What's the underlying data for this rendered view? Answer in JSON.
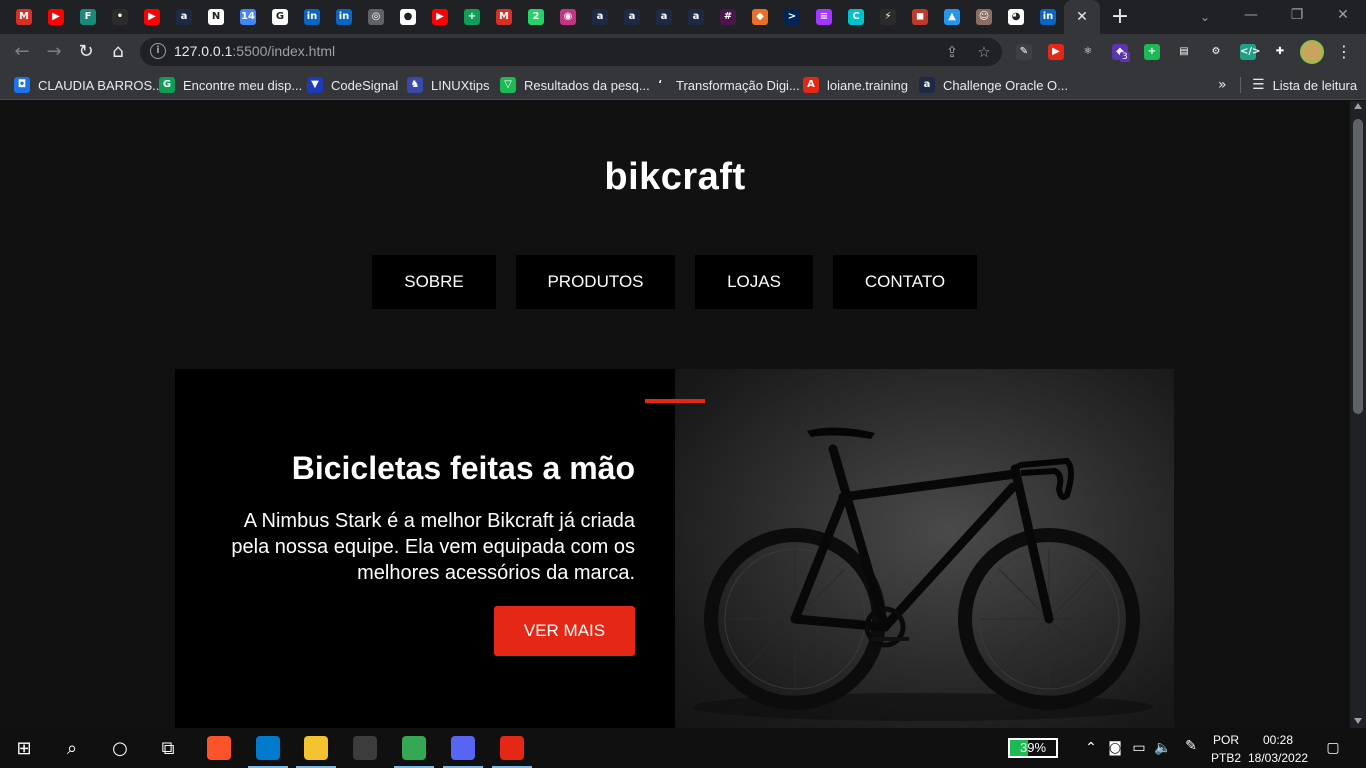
{
  "browser": {
    "url_host": "127.0.0.1",
    "url_rest": ":5500/index.html",
    "active_tab_close": "✕",
    "new_tab": "+"
  },
  "tab_icons": [
    {
      "name": "gmail-tab-icon",
      "color": "#d93025",
      "glyph": "M"
    },
    {
      "name": "youtube-tab-icon",
      "color": "#ff0000",
      "glyph": "▶"
    },
    {
      "name": "forms-tab-icon",
      "color": "#1a8a7a",
      "glyph": "F"
    },
    {
      "name": "dark-tab-icon",
      "color": "#2b2b2b",
      "glyph": "•"
    },
    {
      "name": "youtube-tab-icon",
      "color": "#ff0000",
      "glyph": "▶"
    },
    {
      "name": "alura-tab-icon",
      "color": "#1e2a44",
      "glyph": "a"
    },
    {
      "name": "notion-tab-icon",
      "color": "#ffffff",
      "glyph": "N"
    },
    {
      "name": "calendar-tab-icon",
      "color": "#4285f4",
      "glyph": "14"
    },
    {
      "name": "google-tab-icon",
      "color": "#ffffff",
      "glyph": "G"
    },
    {
      "name": "linkedin-tab-icon",
      "color": "#0a66c2",
      "glyph": "in"
    },
    {
      "name": "linkedin-tab-icon",
      "color": "#0a66c2",
      "glyph": "in"
    },
    {
      "name": "globe-tab-icon",
      "color": "#5f6368",
      "glyph": "◎"
    },
    {
      "name": "record-tab-icon",
      "color": "#ffffff",
      "glyph": "●"
    },
    {
      "name": "youtube-tab-icon",
      "color": "#ff0000",
      "glyph": "▶"
    },
    {
      "name": "sheets-tab-icon",
      "color": "#0f9d58",
      "glyph": "+"
    },
    {
      "name": "gmail-tab-icon",
      "color": "#d93025",
      "glyph": "M"
    },
    {
      "name": "whatsapp-tab-icon",
      "color": "#25d366",
      "glyph": "2"
    },
    {
      "name": "instagram-tab-icon",
      "color": "#c13584",
      "glyph": "◉"
    },
    {
      "name": "alura-tab-icon",
      "color": "#1e2a44",
      "glyph": "a"
    },
    {
      "name": "alura-tab-icon",
      "color": "#1e2a44",
      "glyph": "a"
    },
    {
      "name": "alura-tab-icon",
      "color": "#1e2a44",
      "glyph": "a"
    },
    {
      "name": "alura-tab-icon",
      "color": "#1e2a44",
      "glyph": "a"
    },
    {
      "name": "slack-tab-icon",
      "color": "#4a154b",
      "glyph": "#"
    },
    {
      "name": "app-tab-icon",
      "color": "#e8702a",
      "glyph": "◆"
    },
    {
      "name": "powershell-tab-icon",
      "color": "#012456",
      "glyph": ">"
    },
    {
      "name": "deezer-tab-icon",
      "color": "#a238ff",
      "glyph": "≡"
    },
    {
      "name": "canva-tab-icon",
      "color": "#00c4cc",
      "glyph": "C"
    },
    {
      "name": "bolt-tab-icon",
      "color": "#2b2b2b",
      "glyph": "⚡"
    },
    {
      "name": "app-tab-icon",
      "color": "#c0392b",
      "glyph": "◼"
    },
    {
      "name": "docker-tab-icon",
      "color": "#2496ed",
      "glyph": "▲"
    },
    {
      "name": "avatar-tab-icon",
      "color": "#8d6e63",
      "glyph": "☺"
    },
    {
      "name": "github-tab-icon",
      "color": "#ffffff",
      "glyph": "◕"
    },
    {
      "name": "linkedin-tab-icon",
      "color": "#0a66c2",
      "glyph": "in"
    }
  ],
  "extensions": [
    {
      "name": "pen-extension-icon",
      "color": "#3c4043",
      "glyph": "✎"
    },
    {
      "name": "youtube-extension-icon",
      "color": "#e52815",
      "glyph": "▶"
    },
    {
      "name": "react-devtools-extension-icon",
      "color": "#35363a",
      "glyph": "⚛"
    },
    {
      "name": "purple-extension-icon",
      "color": "#5e35b1",
      "glyph": "◆",
      "badge": "3"
    },
    {
      "name": "add-extension-icon",
      "color": "#1db954",
      "glyph": "+"
    },
    {
      "name": "wappalyzer-extension-icon",
      "color": "#35363a",
      "glyph": "▤"
    },
    {
      "name": "settings-extension-icon",
      "color": "#35363a",
      "glyph": "⚙"
    },
    {
      "name": "code-extension-icon",
      "color": "#1fa187",
      "glyph": "</>"
    },
    {
      "name": "puzzle-extensions-icon",
      "color": "#35363a",
      "glyph": "✚"
    }
  ],
  "bookmarks": [
    {
      "name": "bookmark-claudia-barros",
      "label": "CLAUDIA BARROS...",
      "color": "#1a73e8",
      "glyph": "◘"
    },
    {
      "name": "bookmark-encontre-meu-disp",
      "label": "Encontre meu disp...",
      "color": "#0f9d58",
      "glyph": "G"
    },
    {
      "name": "bookmark-codesignal",
      "label": "CodeSignal",
      "color": "#1a3cbb",
      "glyph": "▼"
    },
    {
      "name": "bookmark-linuxtips",
      "label": "LINUXtips",
      "color": "#3949ab",
      "glyph": "♞"
    },
    {
      "name": "bookmark-resultados-da-pesq",
      "label": "Resultados da pesq...",
      "color": "#1db954",
      "glyph": "▽"
    },
    {
      "name": "bookmark-transformacao-digi",
      "label": "Transformação Digi...",
      "color": "#35363a",
      "glyph": "ʻ"
    },
    {
      "name": "bookmark-loiane-training",
      "label": "loiane.training",
      "color": "#e52815",
      "glyph": "A"
    },
    {
      "name": "bookmark-challenge-oracle",
      "label": "Challenge Oracle O...",
      "color": "#1e2a44",
      "glyph": "a"
    }
  ],
  "bookmarks_more": "»",
  "reading_list": "Lista de leitura",
  "site": {
    "logo": "bikcraft",
    "nav": [
      "SOBRE",
      "PRODUTOS",
      "LOJAS",
      "CONTATO"
    ],
    "hero": {
      "title": "Bicicletas feitas a mão",
      "text": "A Nimbus Stark é a melhor Bikcraft já criada pela nossa equipe. Ela vem equipada com os melhores acessórios da marca.",
      "button": "VER MAIS",
      "accent_color": "#e52815"
    }
  },
  "taskbar": {
    "apps": [
      {
        "name": "brave-taskbar-app",
        "color": "#fb542b",
        "open": false
      },
      {
        "name": "vscode-taskbar-app",
        "color": "#007acc",
        "open": true
      },
      {
        "name": "file-explorer-taskbar-app",
        "color": "#f4c430",
        "open": true
      },
      {
        "name": "terminal-taskbar-app",
        "color": "#3c3c3c",
        "open": false
      },
      {
        "name": "chrome-taskbar-app",
        "color": "#34a853",
        "open": true
      },
      {
        "name": "discord-taskbar-app",
        "color": "#5865f2",
        "open": true
      },
      {
        "name": "snipping-tool-taskbar-app",
        "color": "#e52815",
        "open": true
      }
    ],
    "battery": "39%",
    "battery_level": 0.39,
    "language_top": "POR",
    "language_bottom": "PTB2",
    "time": "00:28",
    "date": "18/03/2022"
  }
}
